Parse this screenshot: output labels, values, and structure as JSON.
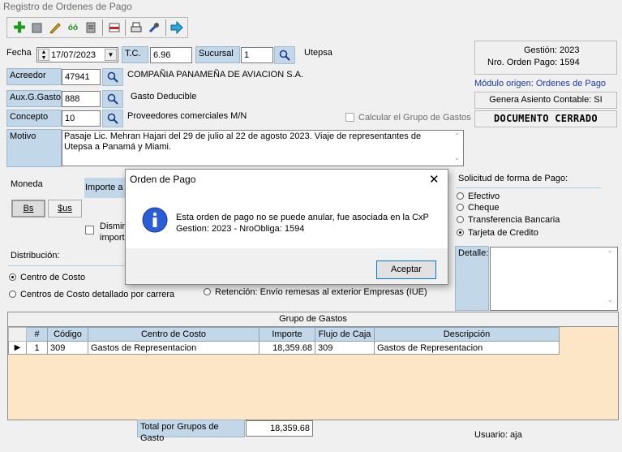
{
  "window": {
    "title": "Registro de Ordenes de Pago"
  },
  "toolbar": {
    "icons": [
      "add-icon",
      "copy-icon",
      "edit-icon",
      "find-icon",
      "list-icon",
      "delete-icon",
      "print-icon",
      "tools-icon",
      "exit-icon"
    ]
  },
  "header": {
    "fecha_label": "Fecha",
    "fecha_value": "17/07/2023",
    "tc_label": "T.C.",
    "tc_value": "6.96",
    "sucursal_label": "Sucursal",
    "sucursal_value": "1",
    "sucursal_name": "Utepsa",
    "acreedor_label": "Acreedor",
    "acreedor_value": "47941",
    "acreedor_name": "COMPAÑIA PANAMEÑA DE AVIACION S.A.",
    "aux_label": "Aux.G.Gasto:",
    "aux_value": "888",
    "aux_name": "Gasto Deducible",
    "concepto_label": "Concepto",
    "concepto_value": "10",
    "concepto_name": "Proveedores comerciales M/N",
    "calcular_label": "Calcular el Grupo de Gastos",
    "motivo_label": "Motivo",
    "motivo_value": "Pasaje Lic. Mehran Hajari del 29 de julio al 22 de agosto 2023. Viaje de representantes de Utepsa a Panamá y Miami."
  },
  "info": {
    "gestion": "Gestión: 2023",
    "nro_orden": "Nro. Orden Pago: 1594",
    "modulo": "Módulo origen: Ordenes de Pago",
    "asiento": "Genera Asiento Contable: SI",
    "estado": "DOCUMENTO CERRADO"
  },
  "moneda": {
    "label": "Moneda",
    "importe_label": "Importe a",
    "bs": "Bs",
    "sus": "$us",
    "dismin": "Dismin",
    "importe2": "importe"
  },
  "distribucion": {
    "label": "Distribución:",
    "centro": "Centro de Costo",
    "detallado": "Centros de Costo detallado por carrera",
    "retencion": "Retención: Envío remesas al exterior Empresas (IUE)"
  },
  "forma_pago": {
    "label": "Solicitud de forma de Pago:",
    "options": [
      "Efectivo",
      "Cheque",
      "Transferencia Bancaria",
      "Tarjeta de Credito"
    ],
    "selected": 3,
    "detalle_label": "Detalle:"
  },
  "grupo": {
    "title": "Grupo de Gastos",
    "columns": [
      "#",
      "Código",
      "Centro de Costo",
      "Importe",
      "Flujo de Caja",
      "Descripción"
    ],
    "rows": [
      {
        "n": "1",
        "codigo": "309",
        "centro": "Gastos de Representacion",
        "importe": "18,359.68",
        "flujo": "309",
        "desc": "Gastos de Representacion"
      }
    ]
  },
  "footer": {
    "total_label": "Total por Grupos de Gasto",
    "total_value": "18,359.68",
    "usuario": "Usuario: aja"
  },
  "dialog": {
    "title": "Orden de Pago",
    "message": "Esta orden de pago no se puede anular, fue asociada en la CxP Gestion: 2023 - NroObliga: 1594",
    "button": "Aceptar",
    "close": "✕"
  }
}
